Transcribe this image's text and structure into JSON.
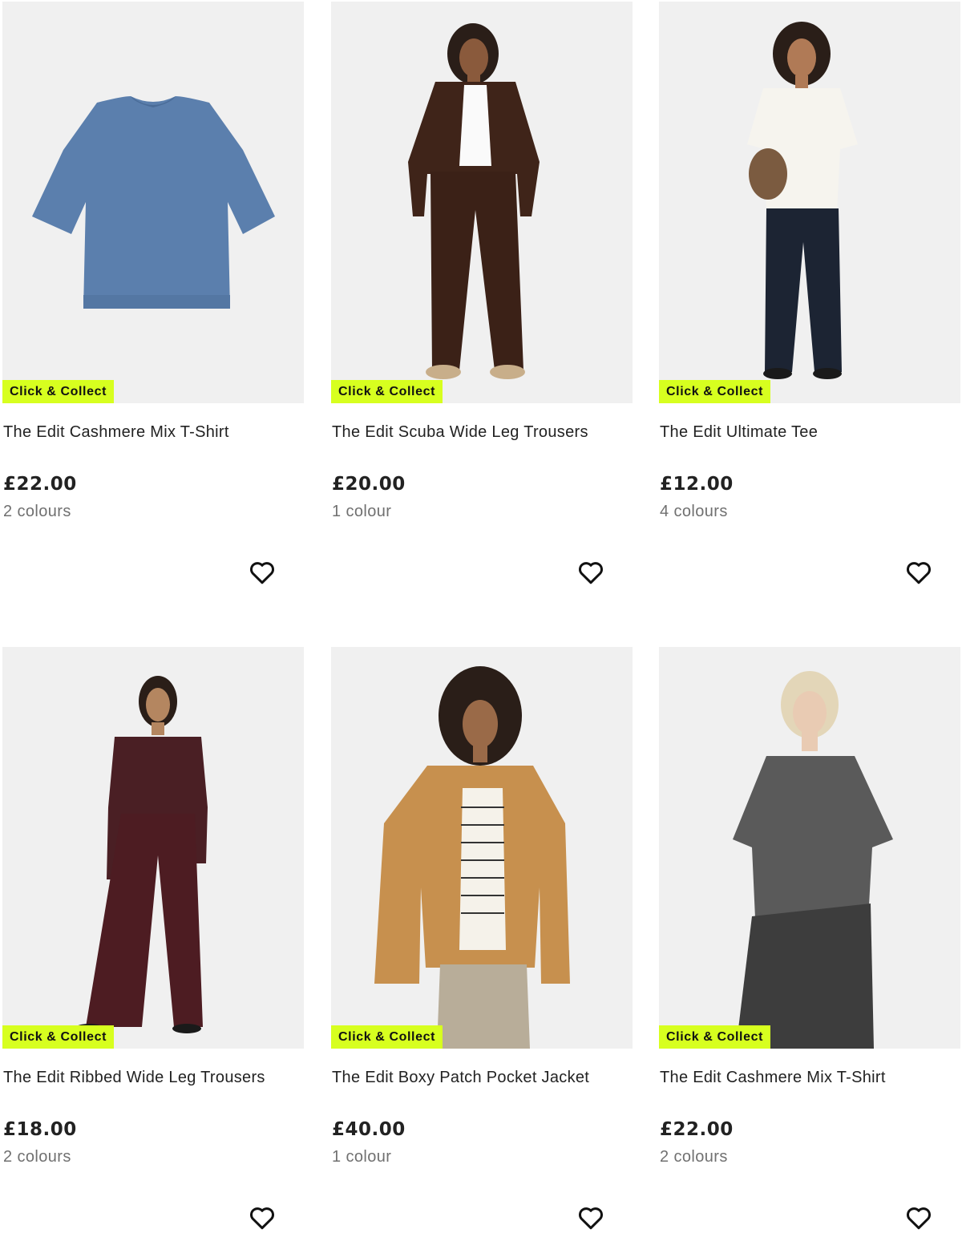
{
  "badge_colour": "#d7ff1f",
  "products": [
    {
      "title": "The Edit Cashmere Mix T-Shirt",
      "price": "£22.00",
      "colours": "2 colours",
      "badge": "Click & Collect",
      "image": "blue-cashmere-tshirt-flatlay",
      "wishlist_icon": "heart-outline-icon"
    },
    {
      "title": "The Edit Scuba Wide Leg Trousers",
      "price": "£20.00",
      "colours": "1 colour",
      "badge": "Click & Collect",
      "image": "model-brown-scuba-set",
      "wishlist_icon": "heart-outline-icon"
    },
    {
      "title": "The Edit Ultimate Tee",
      "price": "£12.00",
      "colours": "4 colours",
      "badge": "Click & Collect",
      "image": "model-white-tee-navy-trousers",
      "wishlist_icon": "heart-outline-icon"
    },
    {
      "title": "The Edit Ribbed Wide Leg Trousers",
      "price": "£18.00",
      "colours": "2 colours",
      "badge": "Click & Collect",
      "image": "model-burgundy-ribbed-set",
      "wishlist_icon": "heart-outline-icon"
    },
    {
      "title": "The Edit Boxy Patch Pocket Jacket",
      "price": "£40.00",
      "colours": "1 colour",
      "badge": "Click & Collect",
      "image": "model-camel-boxy-jacket",
      "wishlist_icon": "heart-outline-icon"
    },
    {
      "title": "The Edit Cashmere Mix T-Shirt",
      "price": "£22.00",
      "colours": "2 colours",
      "badge": "Click & Collect",
      "image": "model-grey-cashmere-tshirt",
      "wishlist_icon": "heart-outline-icon"
    }
  ]
}
